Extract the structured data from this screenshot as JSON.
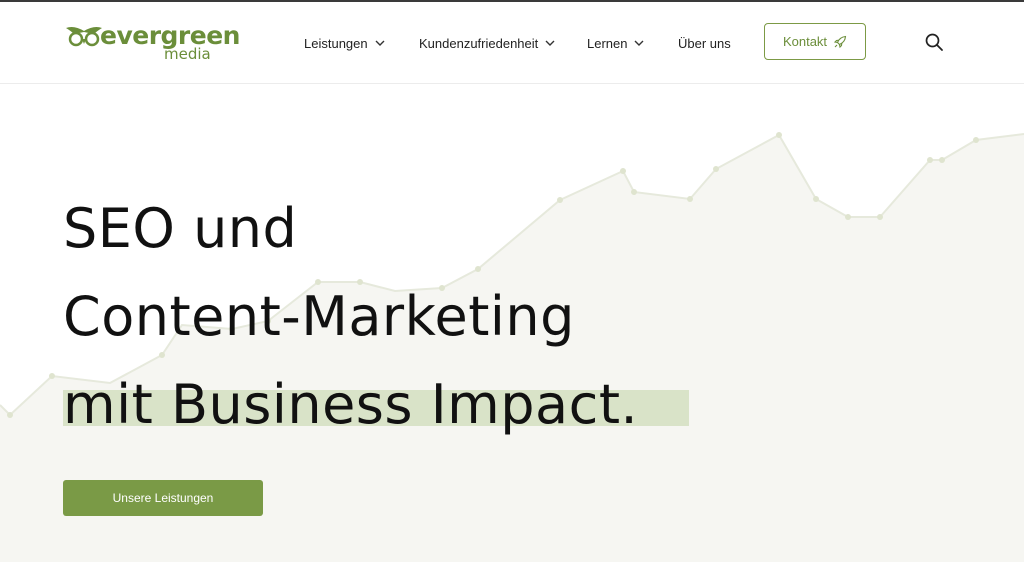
{
  "brand": {
    "name": "evergreen",
    "sub": "media",
    "color": "#6b8e3a"
  },
  "nav": {
    "items": [
      {
        "label": "Leistungen",
        "has_dropdown": true
      },
      {
        "label": "Kundenzufriedenheit",
        "has_dropdown": true
      },
      {
        "label": "Lernen",
        "has_dropdown": true
      },
      {
        "label": "Über uns",
        "has_dropdown": false
      }
    ],
    "contact_label": "Kontakt",
    "contact_icon": "rocket-icon",
    "search_icon": "search-icon"
  },
  "hero": {
    "lines": [
      "SEO und",
      "Content-Marketing",
      "mit Business Impact."
    ],
    "cta_label": "Unsere Leistungen",
    "accent": "#7a9a46",
    "highlight": "#d9e3c8",
    "chart_fill": "#f6f6f2",
    "chart_line": "#e6e9dc",
    "chart_dot": "#dfe4cf"
  }
}
